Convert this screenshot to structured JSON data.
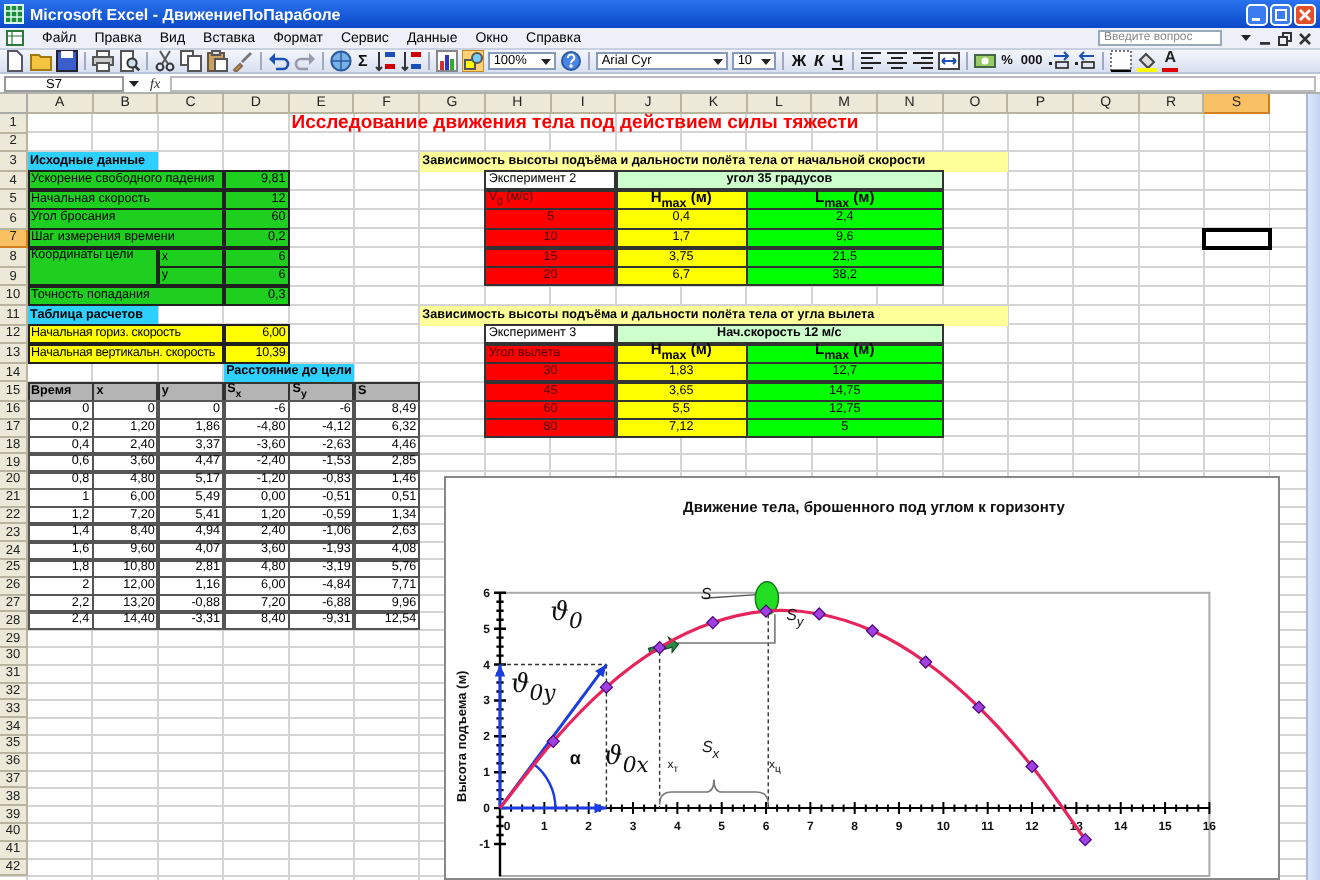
{
  "window": {
    "title": "Microsoft Excel - ДвижениеПоПараболе"
  },
  "menu": [
    "Файл",
    "Правка",
    "Вид",
    "Вставка",
    "Формат",
    "Сервис",
    "Данные",
    "Окно",
    "Справка"
  ],
  "help_search": {
    "placeholder": "Введите вопрос"
  },
  "toolbar": {
    "autosum": "Σ",
    "zoom": "100%",
    "font": "Arial Cyr",
    "size": "10",
    "bold": "Ж",
    "italic": "К",
    "underline": "Ч",
    "percent": "%",
    "thousands": "000",
    "font_color": "A"
  },
  "formula_bar": {
    "name_box": "S7",
    "function": "fx"
  },
  "columns": [
    {
      "label": "A",
      "selected": false
    },
    {
      "label": "B",
      "selected": false
    },
    {
      "label": "C",
      "selected": false
    },
    {
      "label": "D",
      "selected": false
    },
    {
      "label": "E",
      "selected": false
    },
    {
      "label": "F",
      "selected": false
    },
    {
      "label": "G",
      "selected": false
    },
    {
      "label": "H",
      "selected": false
    },
    {
      "label": "I",
      "selected": false
    },
    {
      "label": "J",
      "selected": false
    },
    {
      "label": "K",
      "selected": false
    },
    {
      "label": "L",
      "selected": false
    },
    {
      "label": "M",
      "selected": false
    },
    {
      "label": "N",
      "selected": false
    },
    {
      "label": "O",
      "selected": false
    },
    {
      "label": "P",
      "selected": false
    },
    {
      "label": "Q",
      "selected": false
    },
    {
      "label": "R",
      "selected": false
    },
    {
      "label": "S",
      "selected": true
    }
  ],
  "rows": [
    {
      "label": "1",
      "selected": false
    },
    {
      "label": "2",
      "selected": false
    },
    {
      "label": "3",
      "selected": false
    },
    {
      "label": "4",
      "selected": false
    },
    {
      "label": "5",
      "selected": false
    },
    {
      "label": "6",
      "selected": false
    },
    {
      "label": "7",
      "selected": true
    },
    {
      "label": "8",
      "selected": false
    },
    {
      "label": "9",
      "selected": false
    },
    {
      "label": "10",
      "selected": false
    },
    {
      "label": "11",
      "selected": false
    },
    {
      "label": "12",
      "selected": false
    },
    {
      "label": "13",
      "selected": false
    },
    {
      "label": "14",
      "selected": false
    },
    {
      "label": "15",
      "selected": false
    },
    {
      "label": "16",
      "selected": false
    },
    {
      "label": "17",
      "selected": false
    },
    {
      "label": "18",
      "selected": false
    },
    {
      "label": "19",
      "selected": false
    },
    {
      "label": "20",
      "selected": false
    },
    {
      "label": "21",
      "selected": false
    },
    {
      "label": "22",
      "selected": false
    },
    {
      "label": "23",
      "selected": false
    },
    {
      "label": "24",
      "selected": false
    },
    {
      "label": "25",
      "selected": false
    },
    {
      "label": "26",
      "selected": false
    },
    {
      "label": "27",
      "selected": false
    },
    {
      "label": "28",
      "selected": false
    },
    {
      "label": "29",
      "selected": false
    },
    {
      "label": "30",
      "selected": false
    },
    {
      "label": "31",
      "selected": false
    },
    {
      "label": "32",
      "selected": false
    },
    {
      "label": "33",
      "selected": false
    },
    {
      "label": "34",
      "selected": false
    },
    {
      "label": "35",
      "selected": false
    },
    {
      "label": "36",
      "selected": false
    },
    {
      "label": "37",
      "selected": false
    },
    {
      "label": "38",
      "selected": false
    },
    {
      "label": "39",
      "selected": false
    },
    {
      "label": "40",
      "selected": false
    },
    {
      "label": "41",
      "selected": false
    },
    {
      "label": "42",
      "selected": false
    }
  ],
  "sheet_title": "Исследование движения тела под действием силы тяжести",
  "source_data": {
    "heading": "Исходные данные",
    "items": [
      {
        "label": "Ускорение свободного падения",
        "value": "9,81"
      },
      {
        "label": "Начальная скорость",
        "value": "12"
      },
      {
        "label": "Угол бросания",
        "value": "60"
      },
      {
        "label": "Шаг измерения времени",
        "value": "0,2"
      },
      {
        "label": "Координаты цели",
        "coords": [
          {
            "axis": "x",
            "value": "6"
          },
          {
            "axis": "y",
            "value": "6"
          }
        ]
      },
      {
        "label": "Точность попадания",
        "value": "0,3"
      }
    ]
  },
  "calculations": {
    "heading": "Таблица расчетов",
    "items": [
      {
        "label": "Начальная гориз. скорость",
        "value": "6,00"
      },
      {
        "label": "Начальная вертикальн. скорость",
        "value": "10,39"
      }
    ]
  },
  "distance_heading": "Расстояние до цели",
  "calc_table": {
    "columns": [
      "Время",
      "x",
      "y",
      "S$_{x}$",
      "S$_{y}$",
      "S"
    ],
    "rows": [
      [
        "0",
        "0",
        "0",
        "-6",
        "-6",
        "8,49"
      ],
      [
        "0,2",
        "1,20",
        "1,86",
        "-4,80",
        "-4,12",
        "6,32"
      ],
      [
        "0,4",
        "2,40",
        "3,37",
        "-3,60",
        "-2,63",
        "4,46"
      ],
      [
        "0,6",
        "3,60",
        "4,47",
        "-2,40",
        "-1,53",
        "2,85"
      ],
      [
        "0,8",
        "4,80",
        "5,17",
        "-1,20",
        "-0,83",
        "1,46"
      ],
      [
        "1",
        "6,00",
        "5,49",
        "0,00",
        "-0,51",
        "0,51"
      ],
      [
        "1,2",
        "7,20",
        "5,41",
        "1,20",
        "-0,59",
        "1,34"
      ],
      [
        "1,4",
        "8,40",
        "4,94",
        "2,40",
        "-1,06",
        "2,63"
      ],
      [
        "1,6",
        "9,60",
        "4,07",
        "3,60",
        "-1,93",
        "4,08"
      ],
      [
        "1,8",
        "10,80",
        "2,81",
        "4,80",
        "-3,19",
        "5,76"
      ],
      [
        "2",
        "12,00",
        "1,16",
        "6,00",
        "-4,84",
        "7,71"
      ],
      [
        "2,2",
        "13,20",
        "-0,88",
        "7,20",
        "-6,88",
        "9,96"
      ],
      [
        "2,4",
        "14,40",
        "-3,31",
        "8,40",
        "-9,31",
        "12,54"
      ]
    ]
  },
  "experiments": [
    {
      "heading": "Зависимость высоты подъёма и дальности полёта  тела от начальной скорости",
      "name": "Эксперимент 2",
      "condition": "угол 35 градусов",
      "columns": [
        "V$_{0}$ (м/с)",
        "H$_{max}$ (м)",
        "L$_{max}$ (м)"
      ],
      "rows": [
        [
          "5",
          "0,4",
          "2,4"
        ],
        [
          "10",
          "1,7",
          "9,6"
        ],
        [
          "15",
          "3,75",
          "21,5"
        ],
        [
          "20",
          "6,7",
          "38,2"
        ]
      ]
    },
    {
      "heading": "Зависимость высоты подъёма и дальности полёта  тела от угла вылета",
      "name": "Эксперимент 3",
      "condition": "Нач.скорость 12 м/с",
      "columns": [
        "Угол вылета",
        "H$_{max}$ (м)",
        "L$_{max}$ (м)"
      ],
      "rows": [
        [
          "30",
          "1,83",
          "12,7"
        ],
        [
          "45",
          "3,65",
          "14,75"
        ],
        [
          "60",
          "5,5",
          "12,75"
        ],
        [
          "80",
          "7,12",
          "5"
        ]
      ]
    }
  ],
  "chart": {
    "chart_data": {
      "type": "line",
      "title": "Движение тела, брошенного под углом к горизонту",
      "ylabel": "Высота подъема (м)",
      "x": [
        0,
        1.2,
        2.4,
        3.6,
        4.8,
        6,
        7.2,
        8.4,
        9.6,
        10.8,
        12,
        13.2
      ],
      "series": [
        {
          "color": "#e8245c",
          "marker": "diamond",
          "values": [
            0,
            1.86,
            3.37,
            4.47,
            5.17,
            5.49,
            5.41,
            4.94,
            4.07,
            2.81,
            1.16,
            -0.88
          ]
        }
      ],
      "xlim": [
        0,
        16
      ],
      "ylim": [
        -1.9,
        6
      ],
      "xticks": [
        0,
        1,
        2,
        3,
        4,
        5,
        6,
        7,
        8,
        9,
        10,
        11,
        12,
        13,
        14,
        15,
        16
      ],
      "yticks": [
        -1,
        0,
        1,
        2,
        3,
        4,
        5,
        6
      ],
      "annotations": [
        "ϑ$_{0}$",
        "ϑ$_{0y}$",
        "α",
        "ϑ$_{0x}$",
        "S",
        "S$_{y}$",
        "S$_{x}$",
        "x$_{т}$",
        "x$_{ц}$"
      ]
    }
  }
}
